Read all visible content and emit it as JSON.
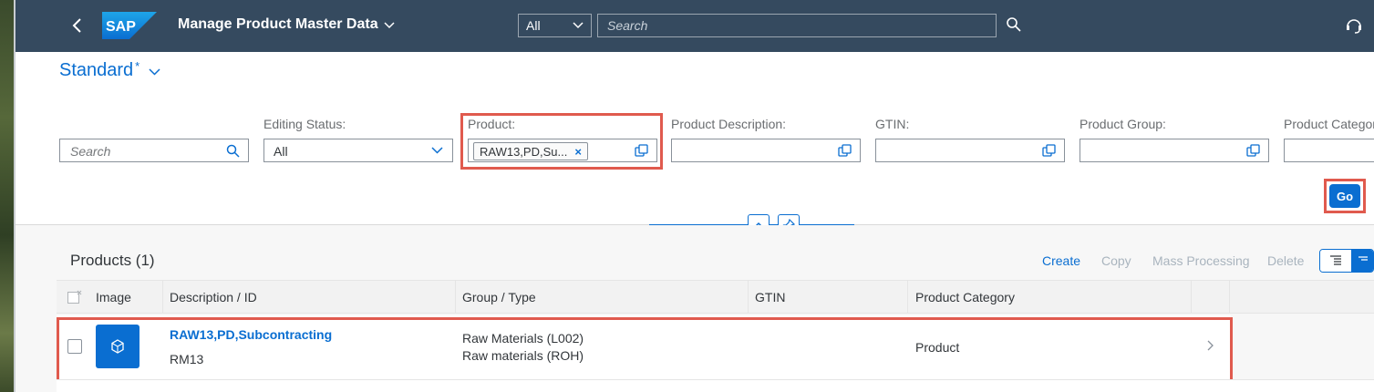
{
  "shell": {
    "logo": "SAP",
    "app_title": "Manage Product Master Data",
    "search_scope": "All",
    "search_placeholder": "Search"
  },
  "variant": {
    "name": "Standard",
    "modified_marker": "*"
  },
  "filter_bar": {
    "search_placeholder": "Search",
    "filters": [
      {
        "label": "Editing Status:",
        "value": "All"
      },
      {
        "label": "Product:",
        "token": "RAW13,PD,Su...",
        "token_remove": "×"
      },
      {
        "label": "Product Description:",
        "value": ""
      },
      {
        "label": "GTIN:",
        "value": ""
      },
      {
        "label": "Product Group:",
        "value": ""
      },
      {
        "label": "Product Categor",
        "value": ""
      }
    ],
    "go_label": "Go"
  },
  "table": {
    "title": "Products (1)",
    "actions": [
      "Create",
      "Copy",
      "Mass Processing",
      "Delete"
    ],
    "columns": [
      "Image",
      "Description / ID",
      "Group / Type",
      "GTIN",
      "Product Category"
    ],
    "rows": [
      {
        "description": "RAW13,PD,Subcontracting",
        "id": "RM13",
        "group": "Raw Materials (L002)",
        "type": "Raw materials (ROH)",
        "gtin": "",
        "category": "Product"
      }
    ]
  },
  "colors": {
    "shell_bg": "#354a5f",
    "accent": "#0a6ed1",
    "highlight": "#e05a4e"
  }
}
